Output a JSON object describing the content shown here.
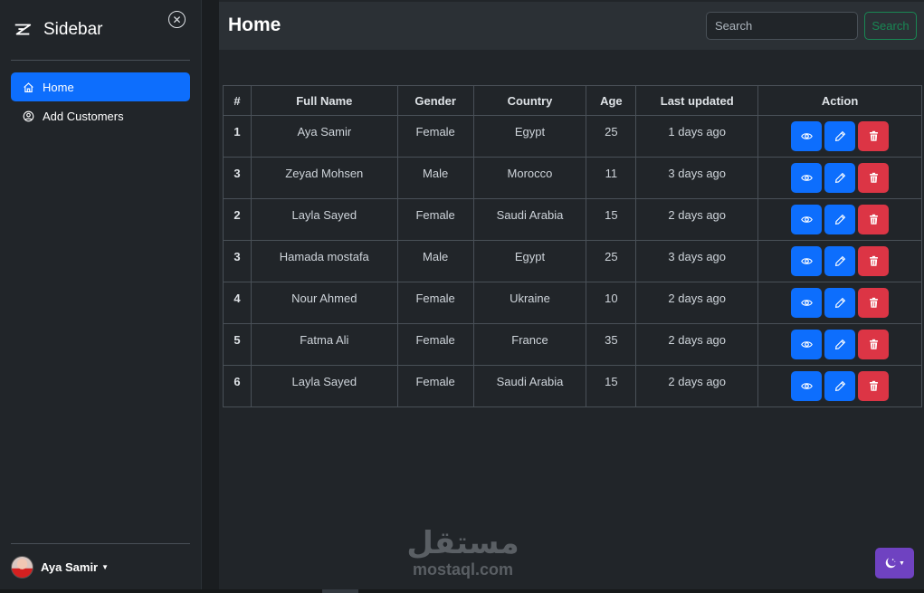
{
  "sidebar": {
    "title": "Sidebar",
    "items": [
      {
        "label": "Home",
        "icon": "house-icon",
        "active": true
      },
      {
        "label": "Add Customers",
        "icon": "person-circle-icon",
        "active": false
      }
    ],
    "user": {
      "name": "Aya Samir"
    }
  },
  "header": {
    "title": "Home",
    "search_placeholder": "Search",
    "search_button": "Search"
  },
  "table": {
    "columns": [
      "#",
      "Full Name",
      "Gender",
      "Country",
      "Age",
      "Last updated",
      "Action"
    ],
    "rows": [
      {
        "num": "1",
        "name": "Aya Samir",
        "gender": "Female",
        "country": "Egypt",
        "age": "25",
        "updated": "1 days ago"
      },
      {
        "num": "3",
        "name": "Zeyad Mohsen",
        "gender": "Male",
        "country": "Morocco",
        "age": "11",
        "updated": "3 days ago"
      },
      {
        "num": "2",
        "name": "Layla Sayed",
        "gender": "Female",
        "country": "Saudi Arabia",
        "age": "15",
        "updated": "2 days ago"
      },
      {
        "num": "3",
        "name": "Hamada mostafa",
        "gender": "Male",
        "country": "Egypt",
        "age": "25",
        "updated": "3 days ago"
      },
      {
        "num": "4",
        "name": "Nour Ahmed",
        "gender": "Female",
        "country": "Ukraine",
        "age": "10",
        "updated": "2 days ago"
      },
      {
        "num": "5",
        "name": "Fatma Ali",
        "gender": "Female",
        "country": "France",
        "age": "35",
        "updated": "2 days ago"
      },
      {
        "num": "6",
        "name": "Layla Sayed",
        "gender": "Female",
        "country": "Saudi Arabia",
        "age": "15",
        "updated": "2 days ago"
      }
    ],
    "action_icons": [
      "eye-icon",
      "pencil-icon",
      "trash-icon"
    ]
  },
  "watermark": {
    "arabic": "مستقل",
    "latin": "mostaql.com"
  },
  "colors": {
    "primary": "#0d6efd",
    "danger": "#dc3545",
    "success": "#198754",
    "purple": "#6f42c1",
    "background": "#212529",
    "topbar": "#2b3035"
  }
}
